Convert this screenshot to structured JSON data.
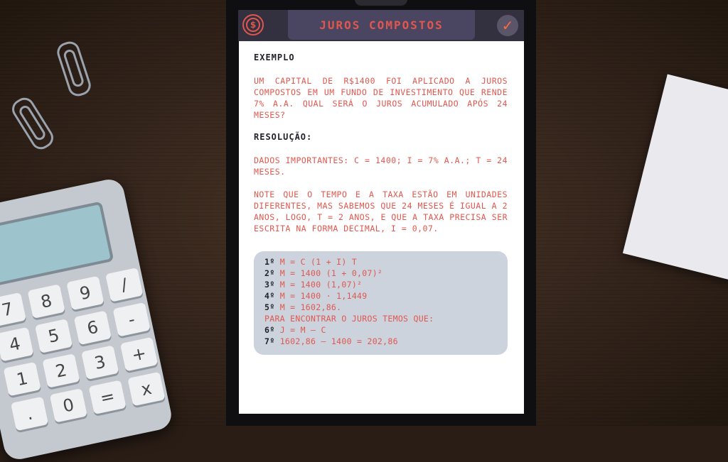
{
  "header": {
    "title": "JUROS COMPOSTOS",
    "coin_icon": "dollar-coin-icon",
    "check_icon": "checkmark-icon",
    "accent_color": "#e0574f"
  },
  "lesson": {
    "example_heading": "EXEMPLO",
    "problem": "UM CAPITAL DE R$1400 FOI APLICADO A JUROS COMPOSTOS EM UM FUNDO DE INVESTIMENTO QUE RENDE 7% A.A. QUAL SERÁ O JUROS ACUMULADO APÓS 24 MESES?",
    "resolution_heading": "RESOLUÇÃO:",
    "data_text": "DADOS IMPORTANTES: C = 1400; I = 7% A.A.; T = 24 MESES.",
    "note_text": "NOTE QUE O TEMPO E A TAXA ESTÃO EM UNIDADES DIFERENTES, MAS SABEMOS QUE 24 MESES É IGUAL A 2 ANOS, LOGO, T = 2 ANOS, E QUE A TAXA PRECISA SER ESCRITA NA FORMA DECIMAL, I = 0,07."
  },
  "steps": [
    {
      "num": "1º",
      "text": "M = C (1 + I) T"
    },
    {
      "num": "2º",
      "text": "M = 1400 (1 + 0,07)²"
    },
    {
      "num": "3º",
      "text": "M = 1400 (1,07)²"
    },
    {
      "num": "4º",
      "text": "M = 1400 · 1,1449"
    },
    {
      "num": "5º",
      "text": "M = 1602,86."
    },
    {
      "num": "",
      "text": "PARA ENCONTRAR O JUROS TEMOS QUE:"
    },
    {
      "num": "6º",
      "text": "J = M – C"
    },
    {
      "num": "7º",
      "text": "1602,86 – 1400 = 202,86"
    }
  ],
  "calculator": {
    "keys": [
      "7",
      "8",
      "9",
      "/",
      "4",
      "5",
      "6",
      "-",
      "1",
      "2",
      "3",
      "+",
      ".",
      "0",
      "=",
      "x"
    ]
  }
}
